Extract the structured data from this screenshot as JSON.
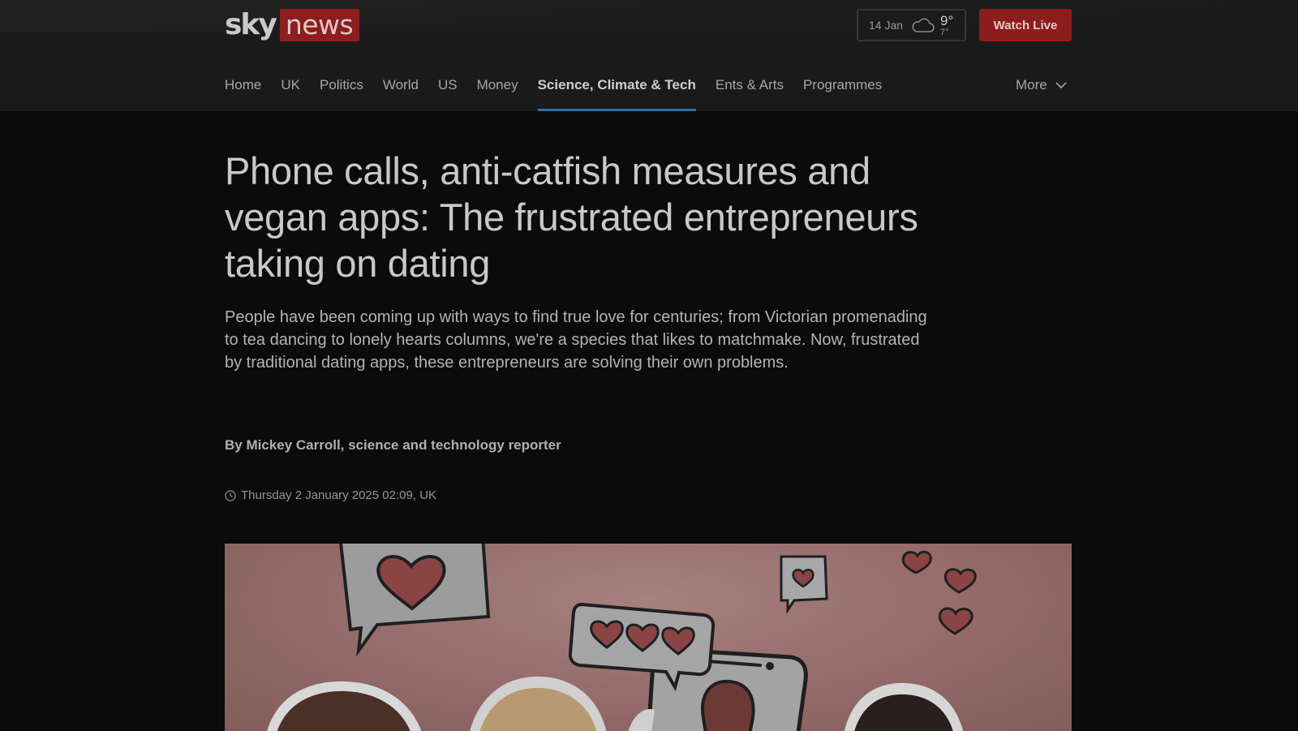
{
  "header": {
    "logo": {
      "sky": "sky",
      "news": "news"
    },
    "weather": {
      "date": "14 Jan",
      "icon": "cloud-icon",
      "high": "9°",
      "low": "7°"
    },
    "watch_live_label": "Watch Live"
  },
  "nav": {
    "items": [
      {
        "label": "Home"
      },
      {
        "label": "UK"
      },
      {
        "label": "Politics"
      },
      {
        "label": "World"
      },
      {
        "label": "US"
      },
      {
        "label": "Money"
      },
      {
        "label": "Science, Climate & Tech",
        "active": true
      },
      {
        "label": "Ents & Arts"
      },
      {
        "label": "Programmes"
      }
    ],
    "more_label": "More"
  },
  "article": {
    "headline": "Phone calls, anti-catfish measures and vegan apps: The frustrated entrepreneurs taking on dating",
    "standfirst": "People have been coming up with ways to find true love for centuries; from Victorian promenading to tea dancing to lonely hearts columns, we're a species that likes to matchmake. Now, frustrated by traditional dating apps, these entrepreneurs are solving their own problems.",
    "byline": "By Mickey Carroll, science and technology reporter",
    "timestamp": "Thursday 2 January 2025 02:09, UK",
    "timestamp_icon": "clock-icon"
  },
  "colors": {
    "brand_red": "#8d1c1c",
    "nav_active_underline": "#2f6fa6",
    "header_bg": "#1a1a1b",
    "page_bg": "#0b0b0c"
  }
}
